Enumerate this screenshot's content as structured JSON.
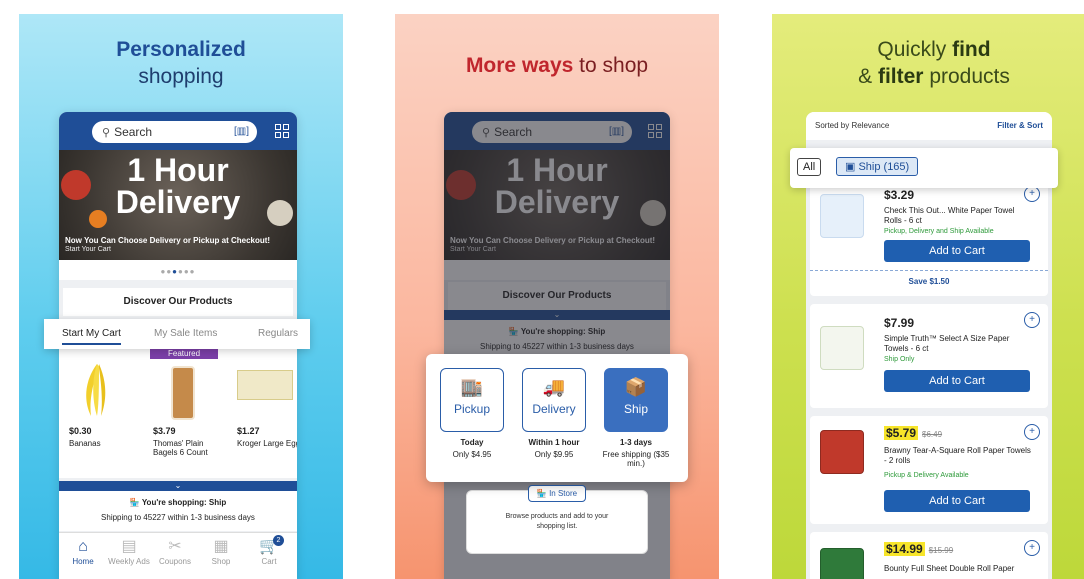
{
  "panel1": {
    "headline_bold": "Personalized",
    "headline_rest": "shopping",
    "search_placeholder": "Search",
    "hero_title_line1": "1 Hour",
    "hero_title_line2": "Delivery",
    "hero_sub": "Now You Can Choose Delivery or Pickup at Checkout!",
    "hero_cta": "Start Your Cart",
    "discover": "Discover Our Products",
    "tabs": [
      "Start My Cart",
      "My Sale Items",
      "Regulars"
    ],
    "featured": "Featured",
    "products": [
      {
        "price": "$0.30",
        "name": "Bananas"
      },
      {
        "price": "$3.79",
        "name": "Thomas' Plain Bagels 6 Count"
      },
      {
        "price": "$1.27",
        "name": "Kroger Large Eggs"
      }
    ],
    "shipping_title": "You're shopping: Ship",
    "shipping_sub": "Shipping to 45227 within 1-3 business days",
    "nav": [
      "Home",
      "Weekly Ads",
      "Coupons",
      "Shop",
      "Cart"
    ],
    "cart_count": "2"
  },
  "panel2": {
    "headline_bold": "More ways",
    "headline_rest": " to shop",
    "options": [
      {
        "label": "Pickup",
        "when": "Today",
        "cost": "Only $4.95"
      },
      {
        "label": "Delivery",
        "when": "Within 1 hour",
        "cost": "Only $9.95"
      },
      {
        "label": "Ship",
        "when": "1-3 days",
        "cost": "Free shipping ($35 min.)"
      }
    ],
    "instore_label": "In Store",
    "instore_desc": "Browse products and add to your shopping list."
  },
  "panel3": {
    "headline_line1_pre": "Quickly ",
    "headline_line1_bold": "find",
    "headline_line2_pre": "& ",
    "headline_line2_bold": "filter",
    "headline_line2_rest": " products",
    "sort_label": "Sorted by Relevance",
    "filter_sort": "Filter & Sort",
    "chip_all": "All",
    "chip_ship": "Ship (165)",
    "items": [
      {
        "price": "$3.29",
        "old": "",
        "name": "Check This Out... White Paper Towel Rolls - 6 ct",
        "avail": "Pickup, Delivery and Ship Available",
        "save": "Save $1.50"
      },
      {
        "price": "$7.99",
        "old": "",
        "name": "Simple Truth™ Select A Size Paper Towels - 6 ct",
        "avail": "Ship Only",
        "save": ""
      },
      {
        "price": "$5.79",
        "old": "$6.49",
        "name": "Brawny Tear-A-Square Roll Paper Towels - 2 rolls",
        "avail": "Pickup & Delivery Available",
        "save": ""
      },
      {
        "price": "$14.99",
        "old": "$15.99",
        "name": "Bounty Full Sheet Double Roll Paper",
        "avail": "",
        "save": ""
      }
    ],
    "add_label": "Add to Cart"
  }
}
